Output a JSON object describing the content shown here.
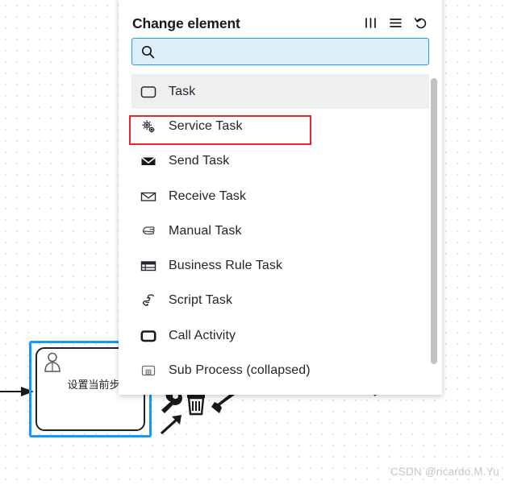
{
  "panel": {
    "title": "Change element",
    "header_icons": [
      {
        "name": "columns-icon",
        "glyph": "columns"
      },
      {
        "name": "list-icon",
        "glyph": "list"
      },
      {
        "name": "undo-icon",
        "glyph": "undo"
      }
    ],
    "search": {
      "placeholder": "",
      "value": "",
      "icon": "search-icon"
    },
    "items": [
      {
        "label": "Task",
        "icon": "task-icon",
        "state": "hovered"
      },
      {
        "label": "Service Task",
        "icon": "service-task-gear-icon",
        "state": "annotated"
      },
      {
        "label": "Send Task",
        "icon": "send-task-envelope-filled-icon",
        "state": "normal"
      },
      {
        "label": "Receive Task",
        "icon": "receive-task-envelope-outline-icon",
        "state": "normal"
      },
      {
        "label": "Manual Task",
        "icon": "manual-task-hand-icon",
        "state": "normal"
      },
      {
        "label": "Business Rule Task",
        "icon": "business-rule-task-table-icon",
        "state": "normal"
      },
      {
        "label": "Script Task",
        "icon": "script-task-scroll-icon",
        "state": "normal"
      },
      {
        "label": "Call Activity",
        "icon": "call-activity-icon",
        "state": "normal"
      },
      {
        "label": "Sub Process (collapsed)",
        "icon": "sub-process-collapsed-icon",
        "state": "normal"
      }
    ]
  },
  "canvas": {
    "task": {
      "label": "设置当前步",
      "icon": "user-task-person-icon",
      "selected": true
    },
    "gateway": {
      "type": "exclusive-gateway"
    },
    "context_pad": [
      {
        "name": "wrench-icon"
      },
      {
        "name": "trash-icon"
      },
      {
        "name": "paintbrush-icon"
      },
      {
        "name": "connect-arrow-icon"
      }
    ]
  },
  "watermark": {
    "text": "CSDN @ricardo.M.Yu"
  },
  "colors": {
    "accent_blue": "#1e9cf5",
    "selection_blue": "#0e9afe",
    "annotation_red": "#e8262b",
    "hover_grey": "#eeeff1",
    "text": "#22262b"
  }
}
